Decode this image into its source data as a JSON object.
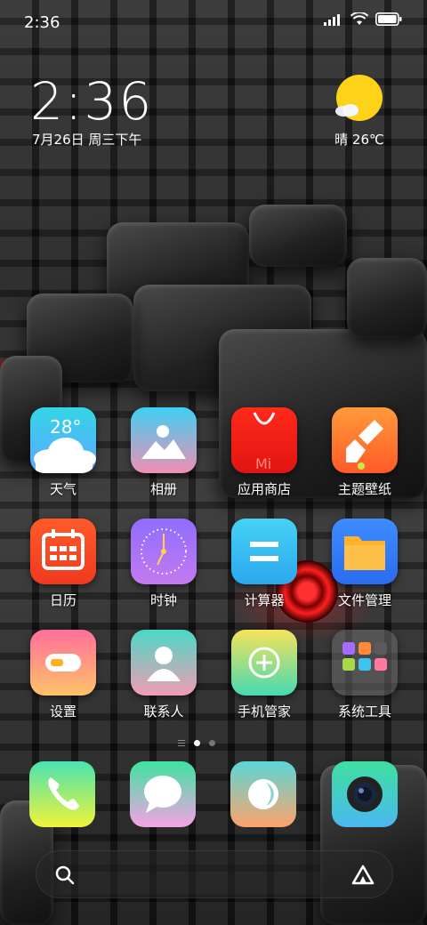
{
  "status_bar": {
    "time": "2:36"
  },
  "clock": {
    "time": "2:36",
    "date": "7月26日 周三下午"
  },
  "weather": {
    "text": "晴 26℃",
    "icon": "sunny-cloud-icon"
  },
  "apps": [
    {
      "label": "天气",
      "icon": "weather-icon",
      "badge": "28°"
    },
    {
      "label": "相册",
      "icon": "gallery-icon"
    },
    {
      "label": "应用商店",
      "icon": "app-store-icon",
      "badge": "Mi"
    },
    {
      "label": "主题壁纸",
      "icon": "themes-icon"
    },
    {
      "label": "日历",
      "icon": "calendar-icon"
    },
    {
      "label": "时钟",
      "icon": "clock-icon"
    },
    {
      "label": "计算器",
      "icon": "calculator-icon"
    },
    {
      "label": "文件管理",
      "icon": "file-manager-icon"
    },
    {
      "label": "设置",
      "icon": "settings-icon"
    },
    {
      "label": "联系人",
      "icon": "contacts-icon"
    },
    {
      "label": "手机管家",
      "icon": "security-icon"
    },
    {
      "label": "系统工具",
      "icon": "folder-icon"
    }
  ],
  "dock": [
    {
      "icon": "phone-icon"
    },
    {
      "icon": "messages-icon"
    },
    {
      "icon": "browser-icon"
    },
    {
      "icon": "camera-icon"
    }
  ],
  "colors": {
    "sun": "#ffd21a"
  }
}
